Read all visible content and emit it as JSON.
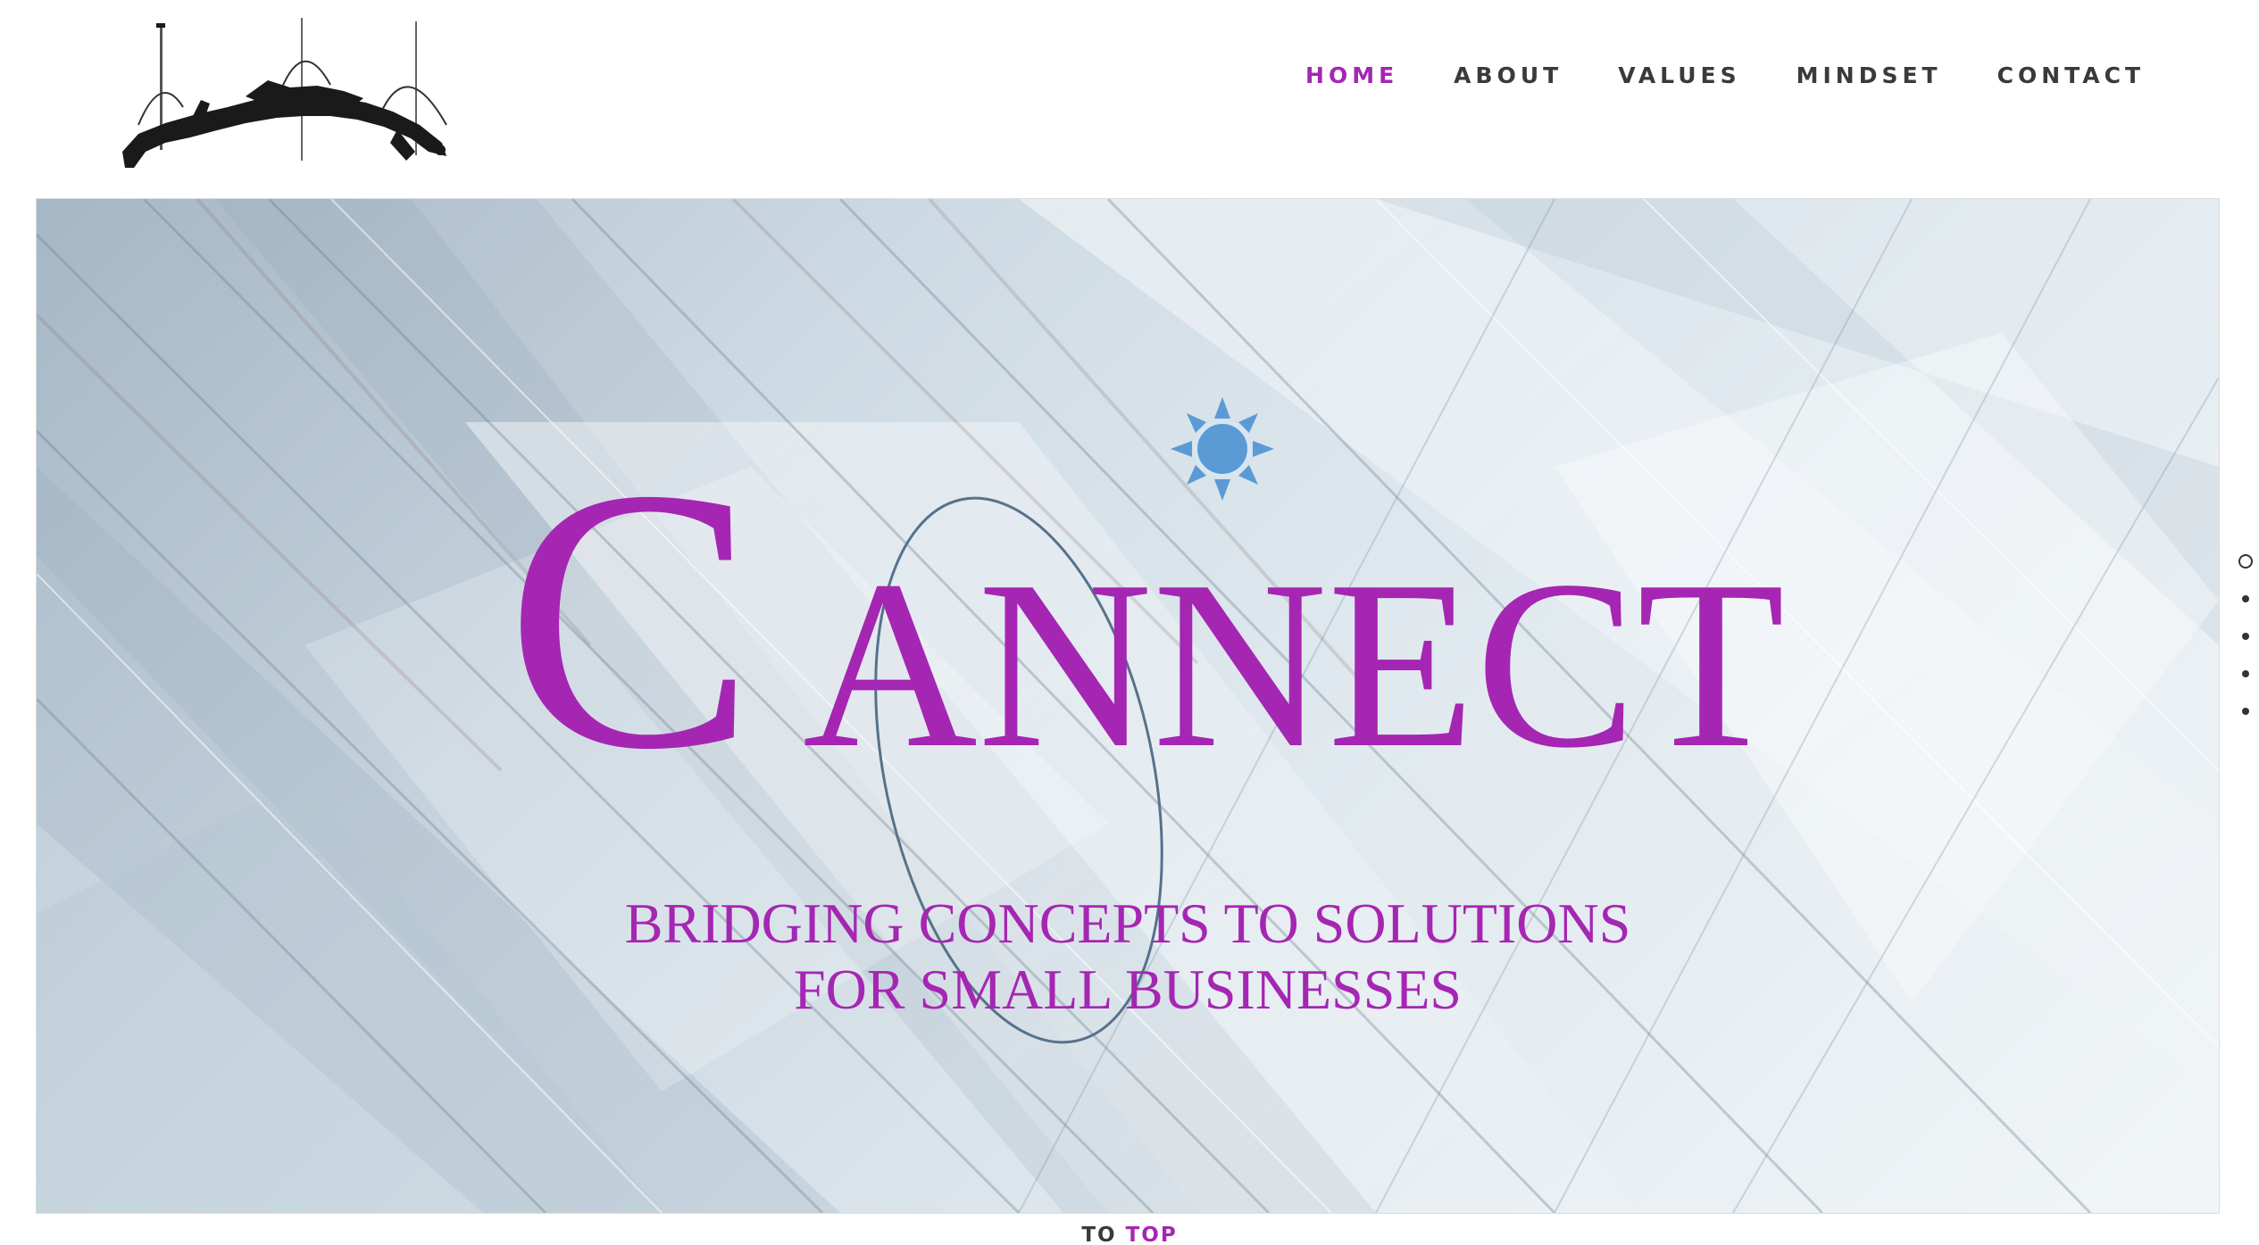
{
  "nav": {
    "items": [
      {
        "label": "HOME",
        "active": true
      },
      {
        "label": "ABOUT",
        "active": false
      },
      {
        "label": "VALUES",
        "active": false
      },
      {
        "label": "MINDSET",
        "active": false
      },
      {
        "label": "CONTACT",
        "active": false
      }
    ]
  },
  "hero": {
    "brand": "CANNECT",
    "tagline_line1": "BRIDGING CONCEPTS TO SOLUTIONS",
    "tagline_line2": "FOR SMALL BUSINESSES"
  },
  "side_nav": {
    "dot_count": 5,
    "active_index": 0
  },
  "footer": {
    "to_label": "TO",
    "top_label": "TOP"
  },
  "colors": {
    "accent": "#a526b3",
    "nav_text": "#3a3a3a",
    "sun": "#5b9bd5",
    "orbit": "#56728c"
  }
}
